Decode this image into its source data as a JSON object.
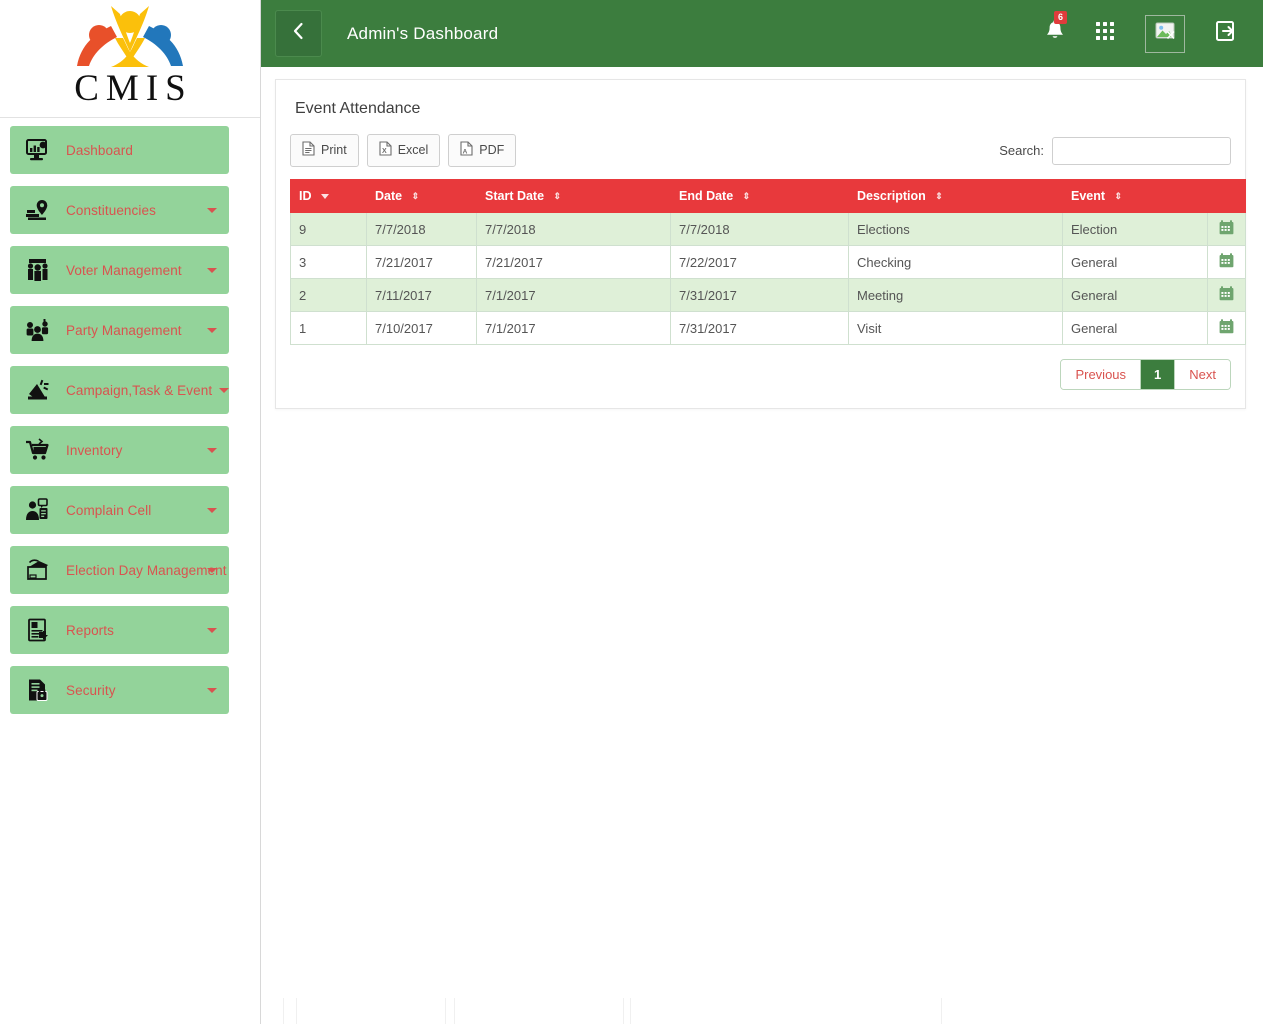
{
  "brand": {
    "name": "CMIS",
    "logo_alt": "cmis-people-logo"
  },
  "sidebar": {
    "items": [
      {
        "label": "Dashboard",
        "icon": "dashboard-monitor-icon",
        "caret": false,
        "active": true
      },
      {
        "label": "Constituencies",
        "icon": "map-pin-icon",
        "caret": true,
        "active": false
      },
      {
        "label": "Voter Management",
        "icon": "voters-group-icon",
        "caret": true,
        "active": false
      },
      {
        "label": "Party Management",
        "icon": "party-people-icon",
        "caret": true,
        "active": false
      },
      {
        "label": "Campaign,Task & Event",
        "icon": "megaphone-icon",
        "caret": true,
        "active": false,
        "inline_caret": true
      },
      {
        "label": "Inventory",
        "icon": "shopping-cart-icon",
        "caret": true,
        "active": false
      },
      {
        "label": "Complain Cell",
        "icon": "complaint-person-icon",
        "caret": true,
        "active": false
      },
      {
        "label": "Election Day Management",
        "icon": "ballot-box-icon",
        "caret": true,
        "active": false
      },
      {
        "label": "Reports",
        "icon": "report-document-icon",
        "caret": true,
        "active": false
      },
      {
        "label": "Security",
        "icon": "document-lock-icon",
        "caret": true,
        "active": false
      }
    ]
  },
  "header": {
    "back_icon": "chevron-left-icon",
    "title": "Admin's Dashboard",
    "actions": [
      {
        "icon": "bell-icon",
        "badge": "6"
      },
      {
        "icon": "apps-grid-icon",
        "badge": ""
      },
      {
        "icon": "broken-image-icon",
        "badge": ""
      },
      {
        "icon": "logout-icon",
        "badge": ""
      }
    ]
  },
  "card": {
    "title": "Event Attendance",
    "buttons": [
      {
        "label": "Print",
        "icon": "print-document-icon"
      },
      {
        "label": "Excel",
        "icon": "excel-file-icon"
      },
      {
        "label": "PDF",
        "icon": "pdf-file-icon"
      }
    ],
    "search": {
      "label": "Search:",
      "value": "",
      "placeholder": ""
    },
    "table": {
      "columns": [
        {
          "label": "ID",
          "sort": "desc"
        },
        {
          "label": "Date",
          "sort": "both"
        },
        {
          "label": "Start Date",
          "sort": "both"
        },
        {
          "label": "End Date",
          "sort": "both"
        },
        {
          "label": "Description",
          "sort": "both"
        },
        {
          "label": "Event",
          "sort": "both"
        },
        {
          "label": "",
          "sort": "none"
        }
      ],
      "rows": [
        {
          "id": "9",
          "date": "7/7/2018",
          "start_date": "7/7/2018",
          "end_date": "7/7/2018",
          "description": "Elections",
          "event": "Election",
          "action_icon": "calendar-icon"
        },
        {
          "id": "3",
          "date": "7/21/2017",
          "start_date": "7/21/2017",
          "end_date": "7/22/2017",
          "description": "Checking",
          "event": "General",
          "action_icon": "calendar-icon"
        },
        {
          "id": "2",
          "date": "7/11/2017",
          "start_date": "7/1/2017",
          "end_date": "7/31/2017",
          "description": "Meeting",
          "event": "General",
          "action_icon": "calendar-icon"
        },
        {
          "id": "1",
          "date": "7/10/2017",
          "start_date": "7/1/2017",
          "end_date": "7/31/2017",
          "description": "Visit",
          "event": "General",
          "action_icon": "calendar-icon"
        }
      ]
    },
    "pagination": {
      "previous": "Previous",
      "pages": [
        "1"
      ],
      "next": "Next",
      "current": "1"
    }
  },
  "colors": {
    "brand_green": "#3c7d3e",
    "sidebar_item": "#93d39a",
    "accent_red": "#d9534f",
    "table_header_red": "#e8393c",
    "row_stripe": "#dff0d8"
  }
}
